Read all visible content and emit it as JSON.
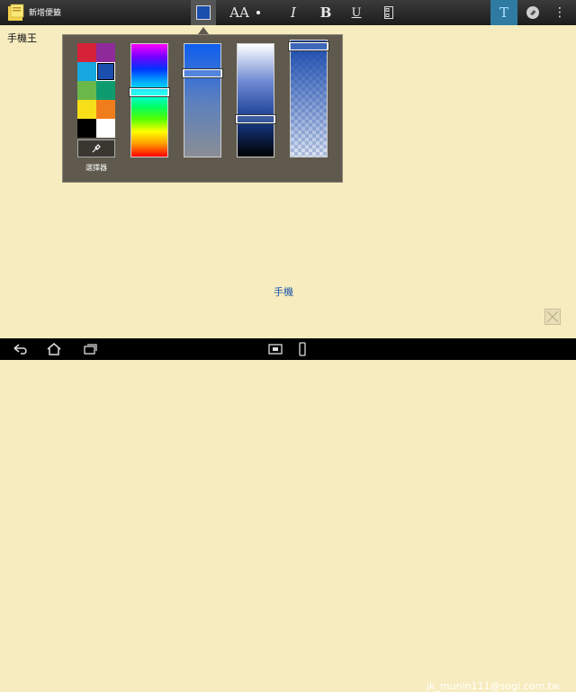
{
  "app": {
    "title": "新增便籤"
  },
  "toolbar": {
    "size_label": "AA",
    "italic_label": "I",
    "bold_label": "B",
    "underline_label": "U",
    "text_mode_label": "T",
    "menu_label": "⋮",
    "current_color": "#1a4fae"
  },
  "document": {
    "text_top": "手機王",
    "text_center": "手機"
  },
  "color_panel": {
    "palette": [
      "#d62238",
      "#8e2a9a",
      "#17a8e0",
      "#1a4fae",
      "#6bb84a",
      "#0e9c6e",
      "#f7e01a",
      "#f07d1b",
      "#000000",
      "#ffffff"
    ],
    "selected_index": 3,
    "picker_label": "選擇器",
    "hue_level": 0.42,
    "saturation_level": 0.24,
    "value_level": 0.68,
    "alpha_level": 0.02
  },
  "watermark": "jk_munin111@sogi.com.tw"
}
